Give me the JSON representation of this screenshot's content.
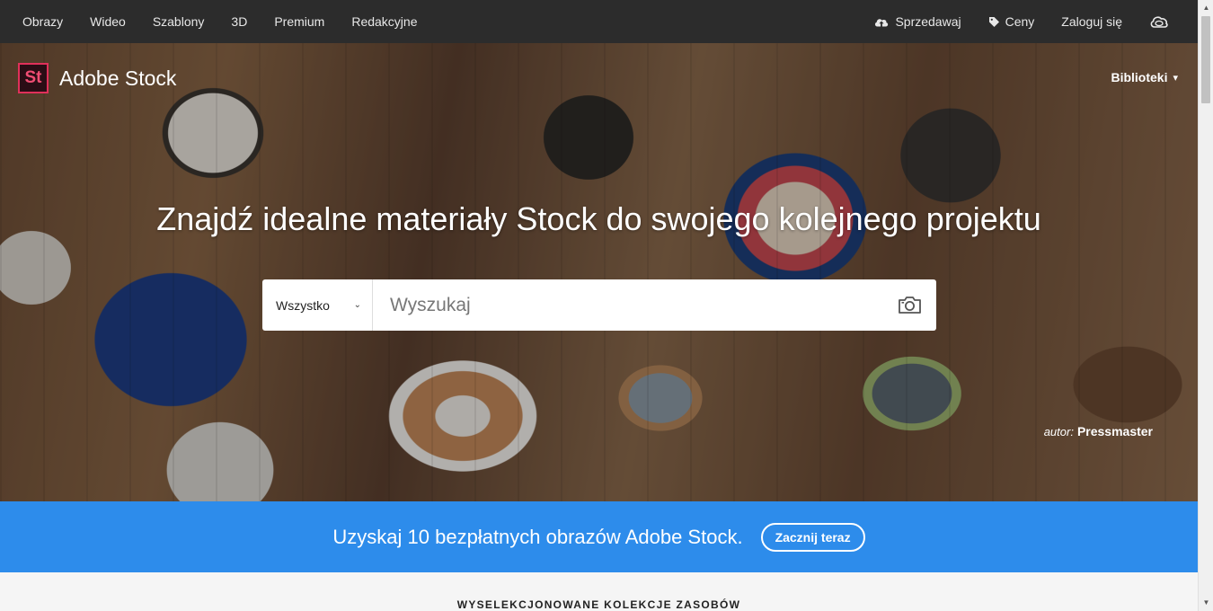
{
  "topnav": {
    "items": [
      "Obrazy",
      "Wideo",
      "Szablony",
      "3D",
      "Premium",
      "Redakcyjne"
    ],
    "sell": "Sprzedawaj",
    "pricing": "Ceny",
    "signin": "Zaloguj się",
    "icons": {
      "sell": "cloud-upload-icon",
      "pricing": "tag-icon",
      "cloud": "creative-cloud-icon"
    }
  },
  "brand": {
    "logo_text": "St",
    "name": "Adobe Stock",
    "accent": "#e0305a"
  },
  "libraries": {
    "label": "Biblioteki"
  },
  "hero": {
    "headline": "Znajdź idealne materiały Stock do swojego kolejnego projektu",
    "credit_prefix": "autor:",
    "credit_author": "Pressmaster"
  },
  "search": {
    "filter_value": "Wszystko",
    "placeholder": "Wyszukaj",
    "value": "",
    "camera_icon": "camera-icon"
  },
  "promo": {
    "text": "Uzyskaj 10 bezpłatnych obrazów Adobe Stock.",
    "button": "Zacznij teraz",
    "background": "#2d8ceb"
  },
  "section": {
    "title": "WYSELEKCJONOWANE KOLEKCJE ZASOBÓW"
  }
}
